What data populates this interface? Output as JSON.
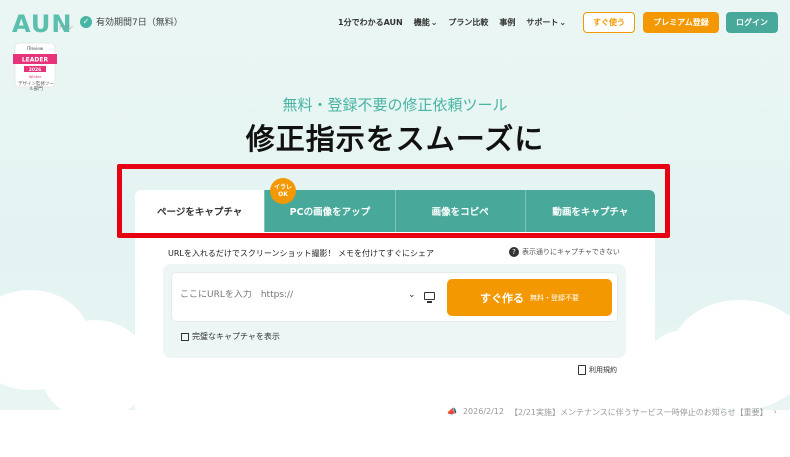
{
  "header": {
    "logo": "AUN",
    "logo_sub": "アウン",
    "trial_text": "有効期間7日（無料）",
    "nav": [
      "1分でわかるAUN",
      "機能",
      "プラン比較",
      "事例",
      "サポート"
    ],
    "buttons": {
      "try": "すぐ使う",
      "premium": "プレミアム登録",
      "login": "ログイン"
    }
  },
  "badge": {
    "brand": "ITreview",
    "title": "LEADER",
    "year": "2026",
    "season": "Winter",
    "caption": "デザイン監修ツール部門"
  },
  "hero": {
    "subtitle": "無料・登録不要の修正依頼ツール",
    "title": "修正指示をスムーズに"
  },
  "tabs": [
    {
      "label": "ページをキャプチャ",
      "active": true
    },
    {
      "label": "PCの画像をアップ",
      "active": false
    },
    {
      "label": "画像をコピペ",
      "active": false
    },
    {
      "label": "動画をキャプチャ",
      "active": false
    }
  ],
  "tab_badge": {
    "line1": "イラレ",
    "line2": "OK"
  },
  "panel": {
    "description": "URLを入れるだけでスクリーンショット撮影！ メモを付けてすぐにシェア",
    "help_text": "表示通りにキャプチャできない",
    "url_placeholder": "ここにURLを入力　https://",
    "capture_button": "すぐ作る",
    "capture_button_sub": "無料・登録不要",
    "full_capture_link": "完璧なキャプチャを表示",
    "terms": "利用規約"
  },
  "news": {
    "date": "2026/2/12",
    "text": "【2/21実施】メンテナンスに伴うサービス一時停止のお知らせ【重要】",
    "arrow": "›"
  },
  "colors": {
    "accent": "#48a89a",
    "orange": "#f39800",
    "highlight": "#e60012"
  }
}
